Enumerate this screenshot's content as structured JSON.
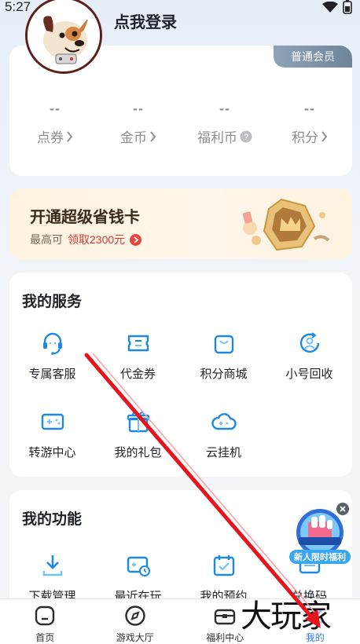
{
  "status_bar": {
    "time": "5:27"
  },
  "profile": {
    "login_text": "点我登录",
    "member_level": "普通会员"
  },
  "assets": [
    {
      "value": "--",
      "label": "点券",
      "suffix": "chevron"
    },
    {
      "value": "--",
      "label": "金币",
      "suffix": "chevron"
    },
    {
      "value": "--",
      "label": "福利币",
      "suffix": "help"
    },
    {
      "value": "--",
      "label": "积分",
      "suffix": "chevron"
    }
  ],
  "saver": {
    "title": "开通超级省钱卡",
    "sub_prefix": "最高可",
    "sub_highlight": "领取2300元"
  },
  "services": {
    "title": "我的服务",
    "items": [
      {
        "label": "专属客服",
        "icon": "headset-icon"
      },
      {
        "label": "代金券",
        "icon": "voucher-icon"
      },
      {
        "label": "积分商城",
        "icon": "shopping-bag-icon"
      },
      {
        "label": "小号回收",
        "icon": "recycle-user-icon"
      },
      {
        "label": "转游中心",
        "icon": "gamepad-icon"
      },
      {
        "label": "我的礼包",
        "icon": "gift-icon"
      },
      {
        "label": "云挂机",
        "icon": "cloud-game-icon"
      }
    ]
  },
  "functions": {
    "title": "我的功能",
    "items": [
      {
        "label": "下载管理",
        "icon": "download-icon"
      },
      {
        "label": "最近在玩",
        "icon": "recent-play-icon"
      },
      {
        "label": "我的预约",
        "icon": "calendar-icon"
      },
      {
        "label": "兑换码",
        "icon": "redeem-code-icon"
      }
    ]
  },
  "float_ad": {
    "label": "新人限时福利"
  },
  "bottom_nav": [
    {
      "label": "首页",
      "icon": "home-icon",
      "active": false
    },
    {
      "label": "游戏大厅",
      "icon": "compass-icon",
      "active": false
    },
    {
      "label": "福利中心",
      "icon": "treasure-chest-icon",
      "active": false
    },
    {
      "label": "我的",
      "icon": "profile-icon",
      "active": true
    }
  ],
  "watermark": "大玩家",
  "colors": {
    "accent": "#2b7cff",
    "icon_blue": "#1e88e5",
    "highlight_red": "#e03a2e",
    "annotation_arrow": "#e8141b"
  }
}
